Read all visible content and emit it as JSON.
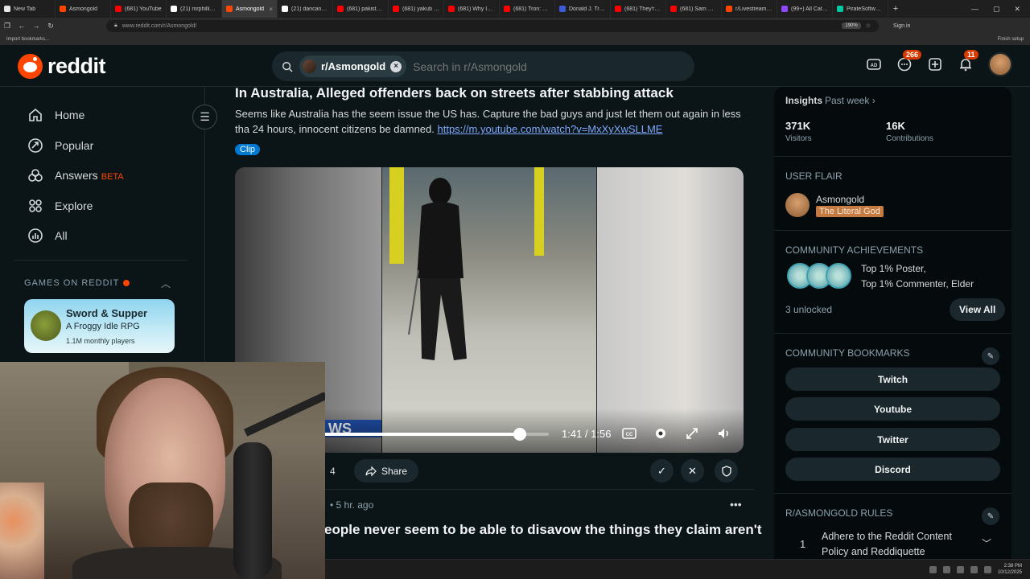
{
  "browser": {
    "tabs": [
      {
        "label": "New Tab",
        "color": "#e8e8e8"
      },
      {
        "label": "Asmongold",
        "color": "#ff4500"
      },
      {
        "label": "(681) YouTube",
        "color": "#ff0000"
      },
      {
        "label": "(21) mrphillipcha…",
        "color": "#ffffff"
      },
      {
        "label": "Asmongold",
        "color": "#ff4500",
        "active": true
      },
      {
        "label": "(21) dancanttwee…",
        "color": "#ffffff"
      },
      {
        "label": "(681) pakistan afg…",
        "color": "#ff0000"
      },
      {
        "label": "(681) yakub - You…",
        "color": "#ff0000"
      },
      {
        "label": "(681) Why Indone…",
        "color": "#ff0000"
      },
      {
        "label": "(681) Tron: Ares -…",
        "color": "#ff0000"
      },
      {
        "label": "Donald J. Trump (…",
        "color": "#3b5bdb"
      },
      {
        "label": "(681) They're so d…",
        "color": "#ff0000"
      },
      {
        "label": "(681) Sam Hyde's…",
        "color": "#ff0000"
      },
      {
        "label": "r/LivestreamFail",
        "color": "#ff4500"
      },
      {
        "label": "(99+) All Categori…",
        "color": "#9146ff"
      },
      {
        "label": "PirateSoftware - S…",
        "color": "#00c8a0"
      }
    ],
    "url": "www.reddit.com/r/Asmongold/",
    "zoom": "190%",
    "signin": "Sign in",
    "import_bookmarks": "Import bookmarks...",
    "finish_setup": "Finish setup"
  },
  "header": {
    "logo_text": "reddit",
    "subreddit_chip": "r/Asmongold",
    "search_placeholder": "Search in r/Asmongold",
    "chat_badge": "266",
    "notif_badge": "11"
  },
  "nav": {
    "items": [
      {
        "label": "Home",
        "icon": "home-icon"
      },
      {
        "label": "Popular",
        "icon": "popular-icon"
      },
      {
        "label": "Answers",
        "icon": "answers-icon"
      },
      {
        "label": "Explore",
        "icon": "explore-icon"
      },
      {
        "label": "All",
        "icon": "all-icon"
      }
    ],
    "beta": "BETA",
    "games_header": "GAMES ON REDDIT",
    "game": {
      "title": "Sword & Supper",
      "subtitle": "A Froggy Idle RPG",
      "players": "1.1M monthly players"
    }
  },
  "post": {
    "title": "In Australia, Alleged offenders back on streets after stabbing attack",
    "body": "Seems like Australia has the seem issue the US has. Capture the bad guys and just let them out again in less tha 24 hours, innocent citizens be damned. ",
    "link": "https://m.youtube.com/watch?v=MxXyXwSLLME",
    "flair": "Clip",
    "video": {
      "news_text": "WS",
      "time": "1:41 / 1:56",
      "progress": 0.87
    },
    "vote_count": "4",
    "share_label": "Share"
  },
  "next_post": {
    "meta": "• 5 hr. ago",
    "more": "•••",
    "title": "eople never seem to be able to disavow the things they claim aren't"
  },
  "sidebar": {
    "insights_label": "Insights",
    "insights_period": "Past week ›",
    "visitors": "371K",
    "visitors_label": "Visitors",
    "contributions": "16K",
    "contributions_label": "Contributions",
    "user_flair_label": "USER FLAIR",
    "flair_user": "Asmongold",
    "flair_tag": "The Literal God",
    "achievements_label": "COMMUNITY ACHIEVEMENTS",
    "achievement_1": "Top 1% Poster,",
    "achievement_2": "Top 1% Commenter, Elder",
    "unlocked": "3 unlocked",
    "view_all": "View All",
    "bookmarks_label": "COMMUNITY BOOKMARKS",
    "bookmarks": [
      "Twitch",
      "Youtube",
      "Twitter",
      "Discord"
    ],
    "rules_label": "R/ASMONGOLD RULES",
    "rule_num": "1",
    "rule_text": "Adhere to the Reddit Content Policy and Reddiquette"
  },
  "taskbar": {
    "time": "2:38 PM",
    "date": "10/12/2025"
  }
}
